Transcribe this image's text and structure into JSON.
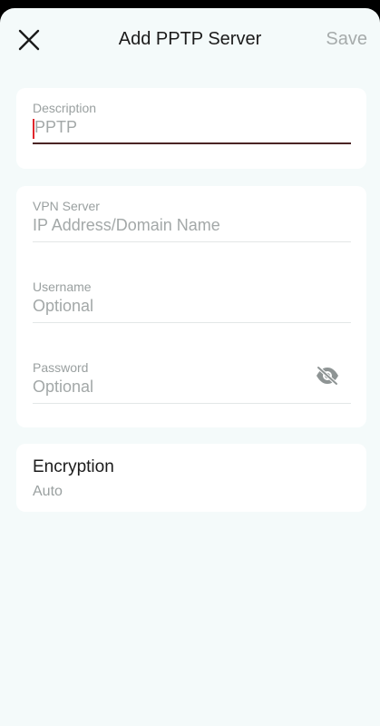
{
  "header": {
    "title": "Add PPTP Server",
    "save_label": "Save"
  },
  "description_field": {
    "label": "Description",
    "value": "PPTP"
  },
  "vpn_server_field": {
    "label": "VPN Server",
    "placeholder": "IP Address/Domain Name"
  },
  "username_field": {
    "label": "Username",
    "placeholder": "Optional"
  },
  "password_field": {
    "label": "Password",
    "placeholder": "Optional",
    "visibility_icon": "eye-off-icon"
  },
  "encryption": {
    "title": "Encryption",
    "value": "Auto"
  },
  "colors": {
    "background": "#f4fafa",
    "card": "#ffffff",
    "cursor": "#e0262c",
    "active_underline": "#4a2424",
    "muted_text": "#9aa0a0"
  }
}
